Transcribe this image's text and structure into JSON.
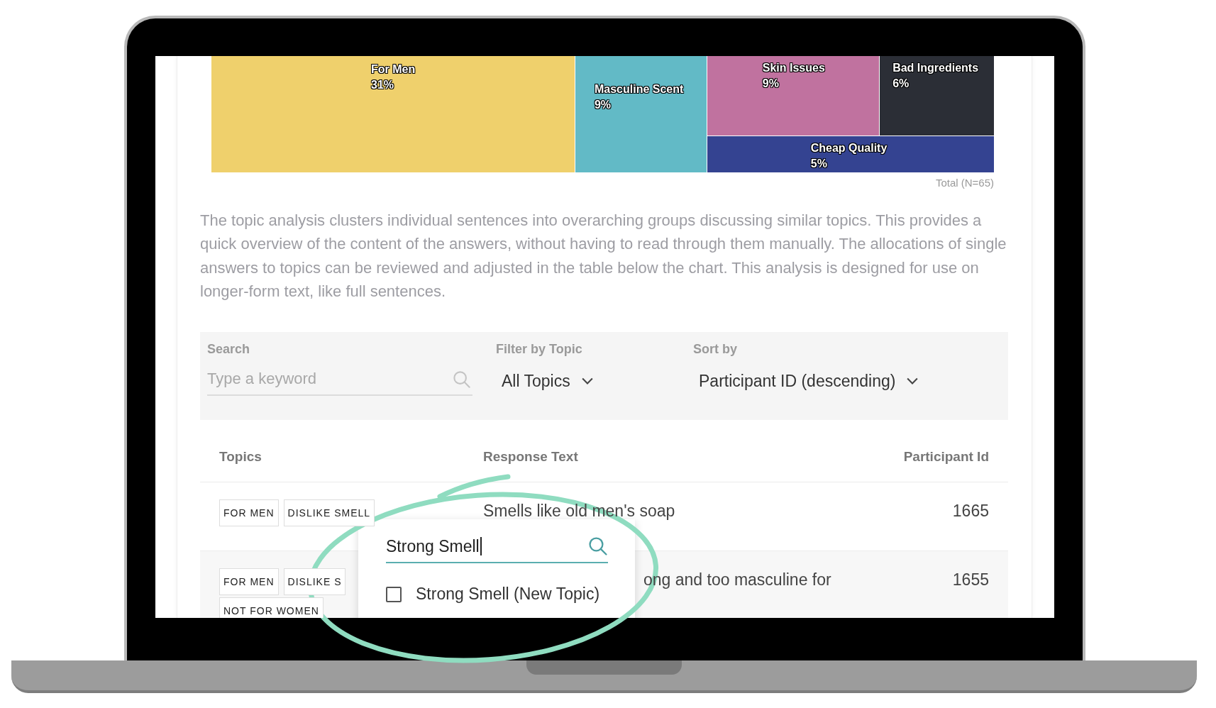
{
  "treemap": {
    "cells": [
      {
        "label": "For Men",
        "percent": "31%",
        "color": "#efd06c"
      },
      {
        "label": "Masculine Scent",
        "percent": "9%",
        "color": "#62bac6"
      },
      {
        "label": "Skin Issues",
        "percent": "9%",
        "color": "#c0729f"
      },
      {
        "label": "Bad Ingredients",
        "percent": "6%",
        "color": "#2b2e36"
      },
      {
        "label": "Cheap Quality",
        "percent": "5%",
        "color": "#344391"
      }
    ],
    "total": "Total (N=65)"
  },
  "description": "The topic analysis clusters individual sentences into overarching groups discussing similar topics. This provides a quick overview of the content of the answers, without having to read through them manually. The allocations of single answers to topics can be reviewed and adjusted in the table below the chart. This analysis is designed for use on longer-form text, like full sentences.",
  "filters": {
    "search": {
      "label": "Search",
      "placeholder": "Type a keyword"
    },
    "topic": {
      "label": "Filter by Topic",
      "value": "All Topics"
    },
    "sort": {
      "label": "Sort by",
      "value": "Participant ID (descending)"
    }
  },
  "table": {
    "columns": [
      "Topics",
      "Response Text",
      "Participant Id"
    ],
    "rows": [
      {
        "topics": [
          "FOR MEN",
          "DISLIKE SMELL"
        ],
        "response": "Smells like old men's soap",
        "participant_id": "1665"
      },
      {
        "topics": [
          "FOR MEN",
          "DISLIKE S",
          "NOT FOR WOMEN"
        ],
        "response": "ong and too masculine for",
        "participant_id": "1655"
      }
    ]
  },
  "topic_popup": {
    "search_value": "Strong Smell",
    "options": [
      {
        "label": "Strong Smell (New Topic)",
        "checked": false
      }
    ]
  }
}
